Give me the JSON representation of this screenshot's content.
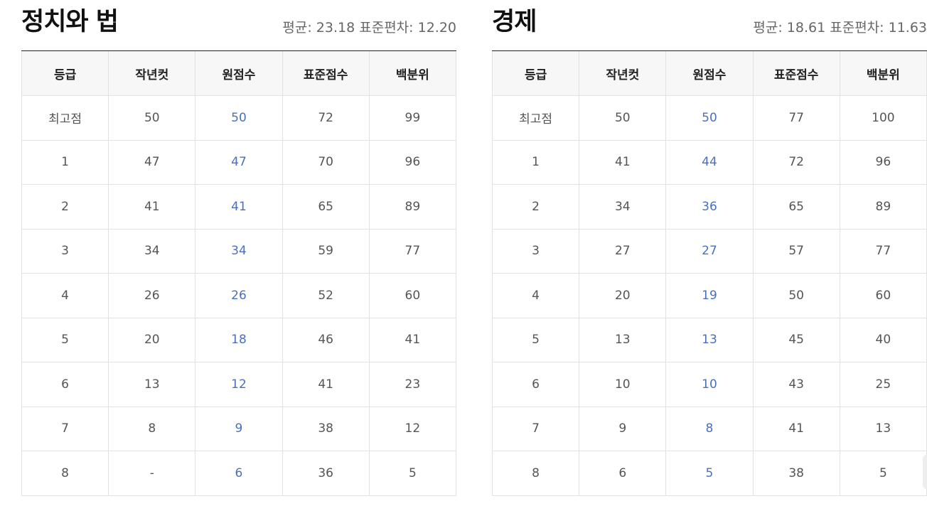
{
  "headers": [
    "등급",
    "작년컷",
    "원점수",
    "표준점수",
    "백분위"
  ],
  "subjects": [
    {
      "title": "정치와 법",
      "stats": "평균: 23.18 표준편차: 12.20",
      "rows": [
        {
          "grade": "최고점",
          "last_cut": "50",
          "raw": "50",
          "standard": "72",
          "percentile": "99"
        },
        {
          "grade": "1",
          "last_cut": "47",
          "raw": "47",
          "standard": "70",
          "percentile": "96"
        },
        {
          "grade": "2",
          "last_cut": "41",
          "raw": "41",
          "standard": "65",
          "percentile": "89"
        },
        {
          "grade": "3",
          "last_cut": "34",
          "raw": "34",
          "standard": "59",
          "percentile": "77"
        },
        {
          "grade": "4",
          "last_cut": "26",
          "raw": "26",
          "standard": "52",
          "percentile": "60"
        },
        {
          "grade": "5",
          "last_cut": "20",
          "raw": "18",
          "standard": "46",
          "percentile": "41"
        },
        {
          "grade": "6",
          "last_cut": "13",
          "raw": "12",
          "standard": "41",
          "percentile": "23"
        },
        {
          "grade": "7",
          "last_cut": "8",
          "raw": "9",
          "standard": "38",
          "percentile": "12"
        },
        {
          "grade": "8",
          "last_cut": "-",
          "raw": "6",
          "standard": "36",
          "percentile": "5"
        }
      ]
    },
    {
      "title": "경제",
      "stats": "평균: 18.61 표준편차: 11.63",
      "rows": [
        {
          "grade": "최고점",
          "last_cut": "50",
          "raw": "50",
          "standard": "77",
          "percentile": "100"
        },
        {
          "grade": "1",
          "last_cut": "41",
          "raw": "44",
          "standard": "72",
          "percentile": "96"
        },
        {
          "grade": "2",
          "last_cut": "34",
          "raw": "36",
          "standard": "65",
          "percentile": "89"
        },
        {
          "grade": "3",
          "last_cut": "27",
          "raw": "27",
          "standard": "57",
          "percentile": "77"
        },
        {
          "grade": "4",
          "last_cut": "20",
          "raw": "19",
          "standard": "50",
          "percentile": "60"
        },
        {
          "grade": "5",
          "last_cut": "13",
          "raw": "13",
          "standard": "45",
          "percentile": "40"
        },
        {
          "grade": "6",
          "last_cut": "10",
          "raw": "10",
          "standard": "43",
          "percentile": "25"
        },
        {
          "grade": "7",
          "last_cut": "9",
          "raw": "8",
          "standard": "41",
          "percentile": "13"
        },
        {
          "grade": "8",
          "last_cut": "6",
          "raw": "5",
          "standard": "38",
          "percentile": "5"
        }
      ]
    }
  ],
  "colors": {
    "raw_score": "#4a6fc0",
    "header_bg": "#f7f7f7",
    "border": "#e2e2e2",
    "title": "#111111"
  }
}
